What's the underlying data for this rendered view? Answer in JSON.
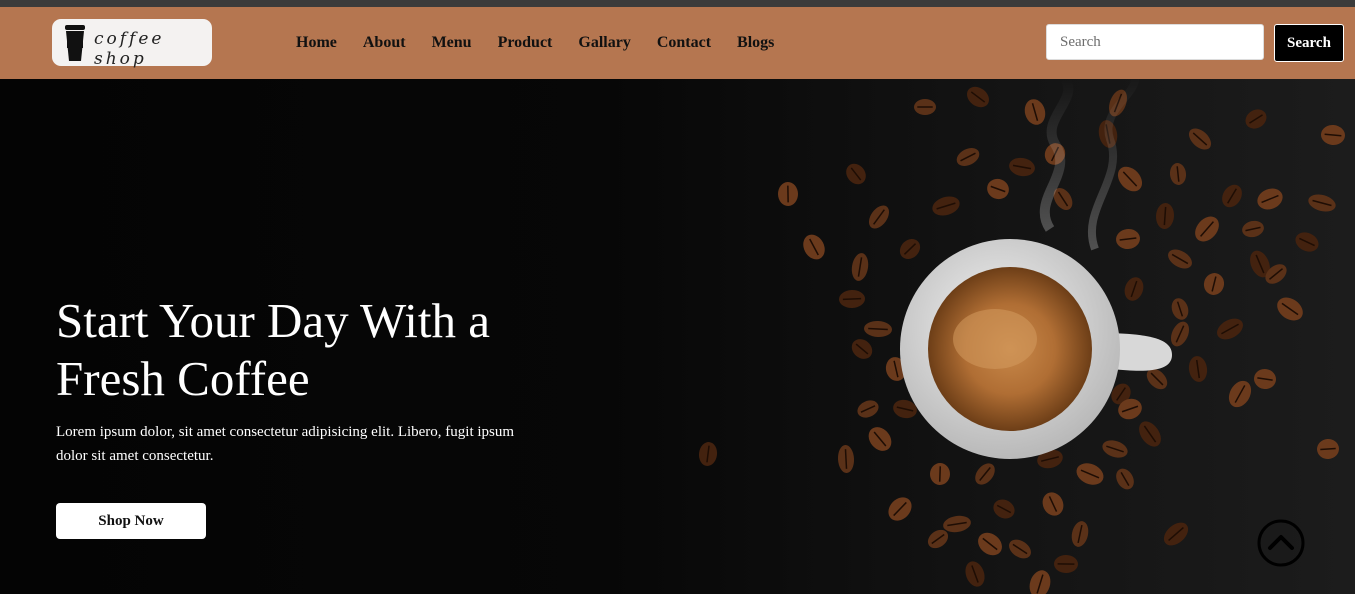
{
  "brand": {
    "logo_text": "coffee shop",
    "logo_icon": "coffee-cup-icon"
  },
  "nav": {
    "links": [
      {
        "label": "Home"
      },
      {
        "label": "About"
      },
      {
        "label": "Menu"
      },
      {
        "label": "Product"
      },
      {
        "label": "Gallary"
      },
      {
        "label": "Contact"
      },
      {
        "label": "Blogs"
      }
    ]
  },
  "search": {
    "placeholder": "Search",
    "button_label": "Search"
  },
  "hero": {
    "title": "Start Your Day With a Fresh Coffee",
    "description": "Lorem ipsum dolor, sit amet consectetur adipisicing elit. Libero, fugit ipsum dolor sit amet consectetur.",
    "cta_label": "Shop Now",
    "image": "coffee-cup-and-beans"
  },
  "scroll_top": {
    "icon": "chevron-up-icon"
  },
  "colors": {
    "navbar": "#b57650",
    "topstrip": "#3b3b3b",
    "hero_bg": "#050505",
    "bean": "#4a2614",
    "cup": "#e6e6e6",
    "crema": "#b77538"
  }
}
